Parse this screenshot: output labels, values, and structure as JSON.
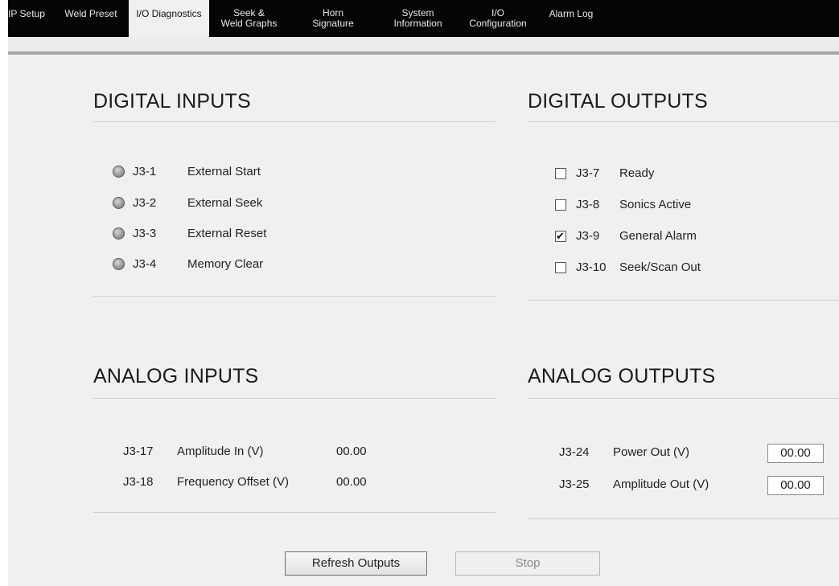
{
  "tabs": [
    {
      "label": "IP Setup",
      "active": false
    },
    {
      "label": "Weld Preset",
      "active": false
    },
    {
      "label": "I/O Diagnostics",
      "active": true
    },
    {
      "label": "Seek &\nWeld Graphs",
      "active": false
    },
    {
      "label": "Horn\nSignature",
      "active": false
    },
    {
      "label": "System\nInformation",
      "active": false
    },
    {
      "label": "I/O\nConfiguration",
      "active": false
    },
    {
      "label": "Alarm Log",
      "active": false
    }
  ],
  "digital_inputs": {
    "title": "DIGITAL INPUTS",
    "items": [
      {
        "pin": "J3-1",
        "label": "External Start"
      },
      {
        "pin": "J3-2",
        "label": "External Seek"
      },
      {
        "pin": "J3-3",
        "label": "External Reset"
      },
      {
        "pin": "J3-4",
        "label": "Memory Clear"
      }
    ]
  },
  "digital_outputs": {
    "title": "DIGITAL OUTPUTS",
    "items": [
      {
        "pin": "J3-7",
        "label": "Ready",
        "checked": false
      },
      {
        "pin": "J3-8",
        "label": "Sonics Active",
        "checked": false
      },
      {
        "pin": "J3-9",
        "label": "General Alarm",
        "checked": true
      },
      {
        "pin": "J3-10",
        "label": "Seek/Scan Out",
        "checked": false
      }
    ]
  },
  "analog_inputs": {
    "title": "ANALOG INPUTS",
    "items": [
      {
        "pin": "J3-17",
        "label": "Amplitude In (V)",
        "value": "00.00"
      },
      {
        "pin": "J3-18",
        "label": "Frequency Offset (V)",
        "value": "00.00"
      }
    ]
  },
  "analog_outputs": {
    "title": "ANALOG OUTPUTS",
    "items": [
      {
        "pin": "J3-24",
        "label": "Power Out (V)",
        "value": "00.00"
      },
      {
        "pin": "J3-25",
        "label": "Amplitude Out (V)",
        "value": "00.00"
      }
    ]
  },
  "buttons": {
    "refresh": "Refresh Outputs",
    "stop": "Stop"
  }
}
